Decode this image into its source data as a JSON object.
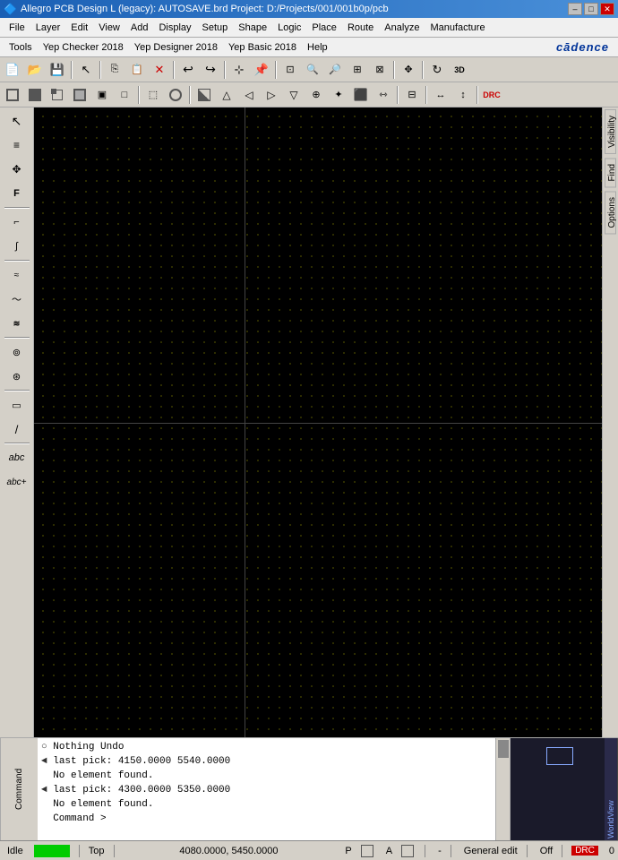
{
  "titlebar": {
    "title": "Allegro PCB Design L (legacy): AUTOSAVE.brd  Project: D:/Projects/001/001b0p/pcb",
    "min_label": "–",
    "max_label": "□",
    "close_label": "✕"
  },
  "menubar1": {
    "items": [
      "File",
      "Layer",
      "Edit",
      "View",
      "Add",
      "Display",
      "Setup",
      "Shape",
      "Logic",
      "Place",
      "Route",
      "Analyze",
      "Manufacture"
    ]
  },
  "menubar2": {
    "items": [
      "Tools",
      "Yep Checker 2018",
      "Yep Designer 2018",
      "Yep Basic 2018",
      "Help"
    ],
    "logo": "cādence"
  },
  "toolbar1": {
    "buttons": [
      "new",
      "open",
      "save",
      "sep",
      "select",
      "sep",
      "copy",
      "paste",
      "delete",
      "sep",
      "undo",
      "redo",
      "sep",
      "snap",
      "pin",
      "sep",
      "zoom-region",
      "zoom-in",
      "zoom-out",
      "zoom-fit",
      "zoom-prev",
      "sep",
      "pan",
      "sep",
      "3d"
    ]
  },
  "toolbar2": {
    "buttons": [
      "sq1",
      "sq2",
      "sq3",
      "sq4",
      "sq5",
      "sq6",
      "sep",
      "sq7",
      "sq8",
      "sep",
      "sq9",
      "sq10",
      "sq11",
      "sq12",
      "sq13",
      "sq14",
      "sq15",
      "sq16",
      "sq17",
      "sep",
      "sq18",
      "sep",
      "sq19",
      "sq20",
      "sq21",
      "sep",
      "sq22"
    ]
  },
  "right_panel": {
    "tabs": [
      "Visibility",
      "Find",
      "Options"
    ]
  },
  "console": {
    "lines": [
      {
        "prefix": "○",
        "text": "Nothing Undo"
      },
      {
        "prefix": "◄",
        "text": "last pick:  4150.0000 5540.0000"
      },
      {
        "prefix": "",
        "text": "No element found."
      },
      {
        "prefix": "◄",
        "text": "last pick:  4300.0000 5350.0000"
      },
      {
        "prefix": "",
        "text": "No element found."
      },
      {
        "prefix": "",
        "text": "Command >"
      }
    ]
  },
  "statusbar": {
    "idle": "Idle",
    "layer": "Top",
    "coords": "4080.0000, 5450.0000",
    "p_label": "P",
    "a_label": "A",
    "dash": "-",
    "general_edit": "General edit",
    "off_label": "Off",
    "drc_label": "DRC",
    "zero": "0"
  }
}
